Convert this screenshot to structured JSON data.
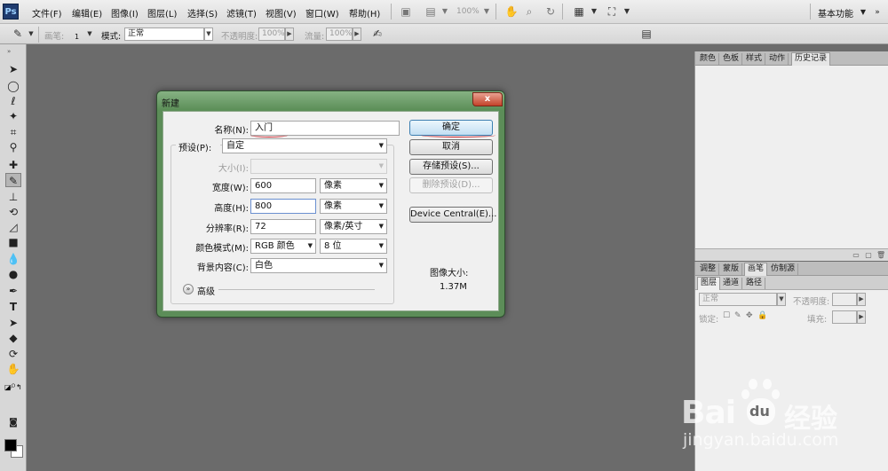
{
  "app": {
    "logo": "Ps"
  },
  "menubar": {
    "items": [
      "文件(F)",
      "编辑(E)",
      "图像(I)",
      "图层(L)",
      "选择(S)",
      "滤镜(T)",
      "视图(V)",
      "窗口(W)",
      "帮助(H)"
    ],
    "zoom": "100%",
    "workspace": "基本功能"
  },
  "options": {
    "brush_label": "画笔:",
    "brush_size": "1",
    "mode_label": "模式:",
    "mode_value": "正常",
    "opacity_label": "不透明度:",
    "opacity_value": "100%",
    "flow_label": "流量:",
    "flow_value": "100%"
  },
  "panels_top": {
    "tabs": [
      "颜色",
      "色板",
      "样式",
      "动作",
      "历史记录"
    ],
    "active_tab": "历史记录"
  },
  "panels_mid": {
    "tabs": [
      "调整",
      "蒙版",
      "画笔",
      "仿制源"
    ],
    "active_tab": "画笔"
  },
  "panels_layers": {
    "tabs": [
      "图层",
      "通道",
      "路径"
    ],
    "active_tab": "图层",
    "blend_mode": "正常",
    "opacity_label": "不透明度:",
    "lock_label": "锁定:",
    "fill_label": "填充:"
  },
  "dialog": {
    "title": "新建",
    "close_label": "x",
    "name_label": "名称(N):",
    "name_value": "入门",
    "preset_label": "预设(P):",
    "preset_value": "自定",
    "size_label": "大小(I):",
    "width_label": "宽度(W):",
    "width_value": "600",
    "width_unit": "像素",
    "height_label": "高度(H):",
    "height_value": "800",
    "height_unit": "像素",
    "resolution_label": "分辨率(R):",
    "resolution_value": "72",
    "resolution_unit": "像素/英寸",
    "color_mode_label": "颜色模式(M):",
    "color_mode_value": "RGB 颜色",
    "bit_depth": "8 位",
    "background_label": "背景内容(C):",
    "background_value": "白色",
    "advanced_label": "高级",
    "ok_label": "确定",
    "cancel_label": "取消",
    "save_preset_label": "存储预设(S)...",
    "delete_preset_label": "删除预设(D)...",
    "device_central_label": "Device Central(E)...",
    "image_size_label": "图像大小:",
    "image_size_value": "1.37M"
  },
  "watermark": {
    "brand_latin": "Bai",
    "brand_paw": "du",
    "brand_cn": "经验",
    "url": "jingyan.baidu.com"
  },
  "colors": {
    "workspace_bg": "#6b6b6b",
    "dialog_frame": "#5c8d58",
    "close_button": "#c4432a",
    "annotation": "#c6262e"
  }
}
